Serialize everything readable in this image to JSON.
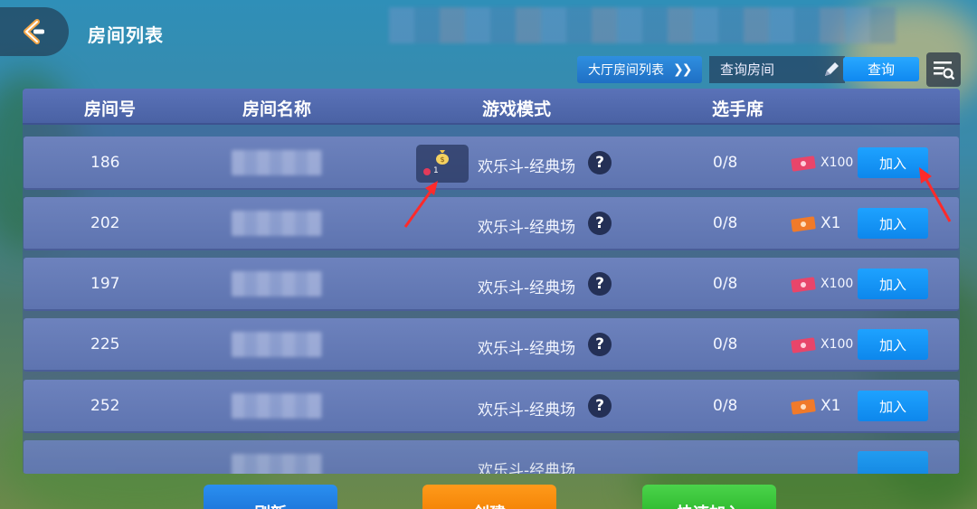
{
  "header": {
    "title": "房间列表"
  },
  "toolbar": {
    "lobby_list_label": "大厅房间列表",
    "search_placeholder": "查询房间",
    "search_button": "查询"
  },
  "table": {
    "columns": [
      "房间号",
      "房间名称",
      "游戏模式",
      "选手席"
    ],
    "rows": [
      {
        "id": "186",
        "mode": "欢乐斗-经典场",
        "seats": "0/8",
        "ticket": "X100",
        "join": "加入",
        "badge_count": "1"
      },
      {
        "id": "202",
        "mode": "欢乐斗-经典场",
        "seats": "0/8",
        "ticket": "X1",
        "join": "加入"
      },
      {
        "id": "197",
        "mode": "欢乐斗-经典场",
        "seats": "0/8",
        "ticket": "X100",
        "join": "加入"
      },
      {
        "id": "225",
        "mode": "欢乐斗-经典场",
        "seats": "0/8",
        "ticket": "X100",
        "join": "加入"
      },
      {
        "id": "252",
        "mode": "欢乐斗-经典场",
        "seats": "0/8",
        "ticket": "X1",
        "join": "加入"
      },
      {
        "id": "",
        "mode": "欢乐斗-经典场",
        "seats": "",
        "ticket": "",
        "join": ""
      }
    ],
    "help_glyph": "?"
  },
  "bottom": {
    "refresh": "刷新",
    "create": "创建",
    "quick_join": "快速加入"
  },
  "colors": {
    "join_blue": "#1ea2ff",
    "refresh_blue": "#2a8ff0",
    "create_orange": "#ff9a1a",
    "quick_green": "#4bd34b",
    "annotation_red": "#ff2a2a"
  },
  "icons": {
    "back": "back-arrow-icon",
    "edit": "pencil-icon",
    "list_search": "list-search-icon",
    "help": "question-icon",
    "ticket": "ticket-icon",
    "bag": "money-bag-icon"
  }
}
